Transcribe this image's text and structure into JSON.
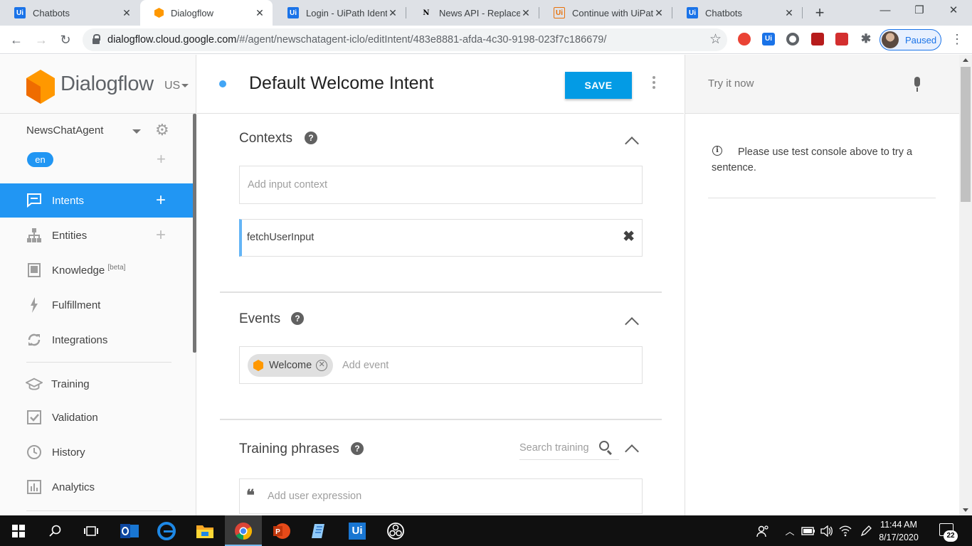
{
  "browser": {
    "tabs": [
      {
        "title": "Chatbots",
        "favicon": "uipath-icon",
        "active": false
      },
      {
        "title": "Dialogflow",
        "favicon": "dialogflow-icon",
        "active": true
      },
      {
        "title": "Login - UiPath Identi",
        "favicon": "uipath-icon",
        "active": false
      },
      {
        "title": "News API - Replacem",
        "favicon": "notion-icon",
        "active": false
      },
      {
        "title": "Continue with UiPath",
        "favicon": "uipath-orange-icon",
        "active": false
      },
      {
        "title": "Chatbots",
        "favicon": "uipath-icon",
        "active": false
      }
    ],
    "url_host": "dialogflow.cloud.google.com",
    "url_path": "/#/agent/newschatagent-iclo/editIntent/483e8881-afda-4c30-9198-023f7c186679/",
    "profile_label": "Paused",
    "favicon_ui_text": "Ui",
    "favicon_n_text": "N"
  },
  "sidebar": {
    "brand": "Dialogflow",
    "region": "US",
    "agent_name": "NewsChatAgent",
    "language": "en",
    "items": [
      {
        "label": "Intents",
        "icon": "chat-icon",
        "active": true,
        "addable": true
      },
      {
        "label": "Entities",
        "icon": "hierarchy-icon",
        "active": false,
        "addable": true
      },
      {
        "label": "Knowledge",
        "badge": "[beta]",
        "icon": "book-icon",
        "active": false,
        "addable": false
      },
      {
        "label": "Fulfillment",
        "icon": "lightning-icon",
        "active": false,
        "addable": false
      },
      {
        "label": "Integrations",
        "icon": "sync-icon",
        "active": false,
        "addable": false
      },
      {
        "label": "Training",
        "icon": "graduation-cap-icon",
        "active": false,
        "addable": false
      },
      {
        "label": "Validation",
        "icon": "checkbox-icon",
        "active": false,
        "addable": false
      },
      {
        "label": "History",
        "icon": "clock-icon",
        "active": false,
        "addable": false
      },
      {
        "label": "Analytics",
        "icon": "bar-chart-icon",
        "active": false,
        "addable": false
      }
    ]
  },
  "editor": {
    "intent_title": "Default Welcome Intent",
    "save_label": "SAVE",
    "contexts": {
      "title": "Contexts",
      "input_placeholder": "Add input context",
      "output_context": "fetchUserInput"
    },
    "events": {
      "title": "Events",
      "chip_label": "Welcome",
      "input_placeholder": "Add event"
    },
    "training": {
      "title": "Training phrases",
      "search_placeholder": "Search training",
      "input_placeholder": "Add user expression"
    }
  },
  "console": {
    "input_placeholder": "Try it now",
    "info_text": "Please use test console above to try a sentence."
  },
  "taskbar": {
    "time": "11:44 AM",
    "date": "8/17/2020",
    "notifications": "22",
    "apps": [
      "outlook-icon",
      "edge-icon",
      "file-explorer-icon",
      "chrome-icon",
      "powerpoint-icon",
      "notepad-icon",
      "uipath-icon",
      "obs-icon"
    ]
  },
  "colors": {
    "accent": "#2196f3",
    "save_button": "#039be5",
    "dialogflow_orange": "#ff9800"
  }
}
